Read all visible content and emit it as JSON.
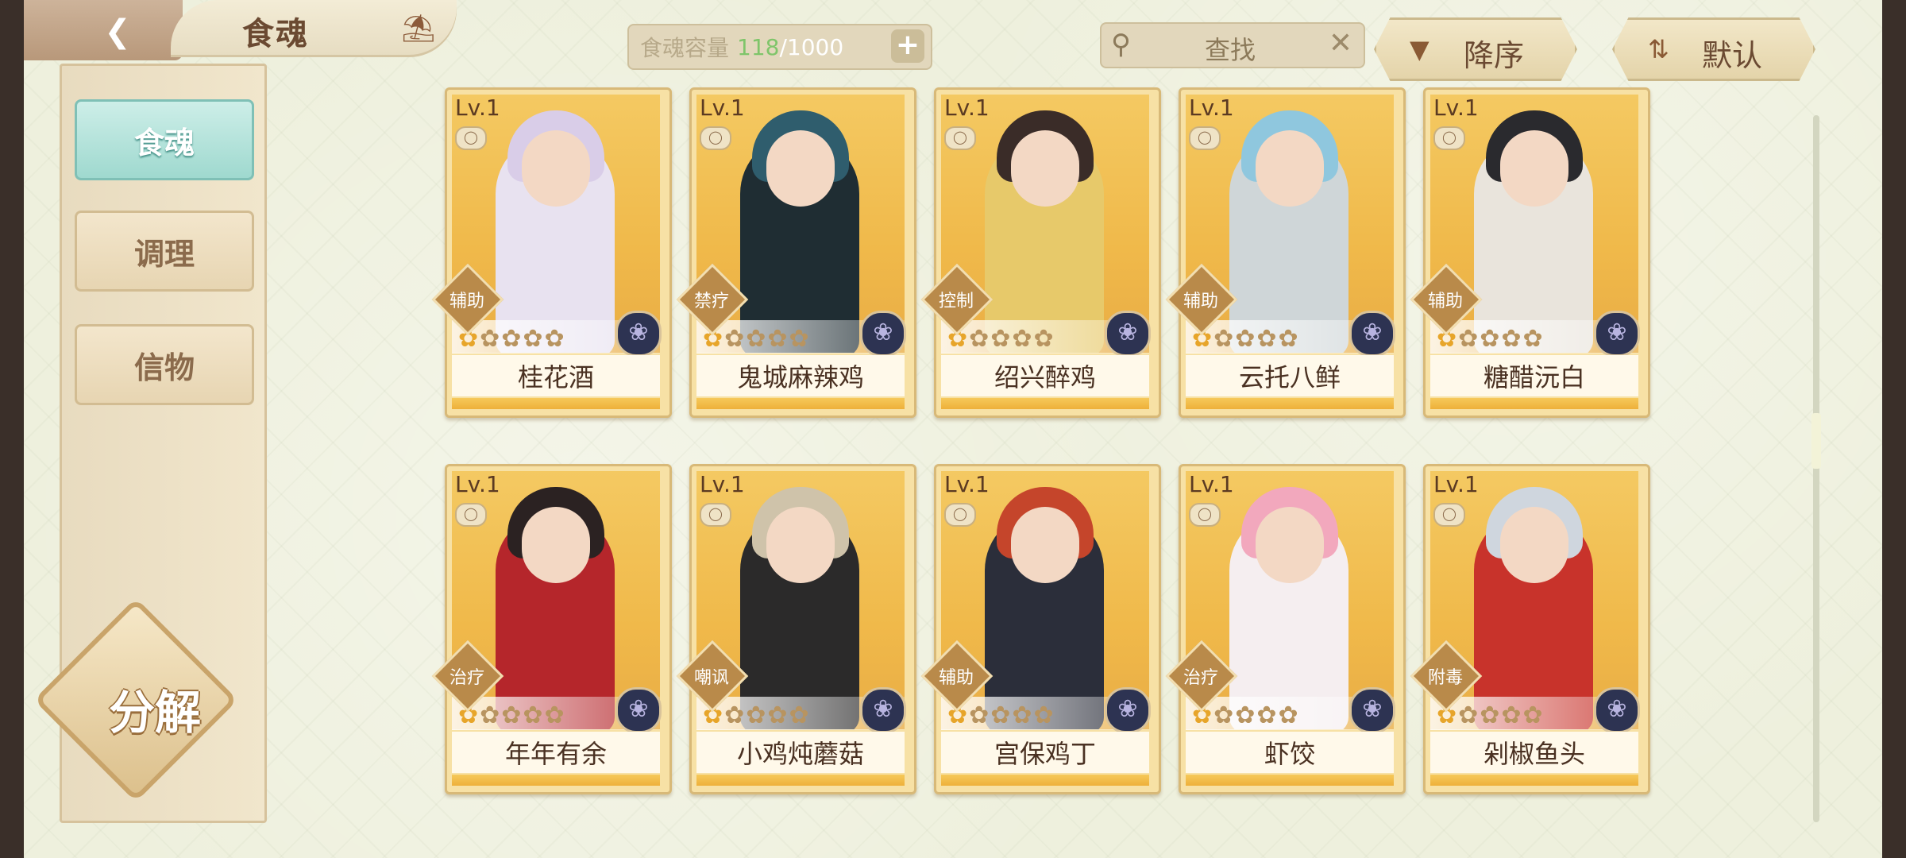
{
  "header": {
    "title": "食魂",
    "capacity_label": "食魂容量",
    "capacity_current": "118",
    "capacity_max": "/1000",
    "search_text": "查找",
    "sort_desc_label": "降序",
    "sort_default_label": "默认"
  },
  "sidebar": {
    "items": [
      {
        "label": "食魂",
        "active": true
      },
      {
        "label": "调理",
        "active": false
      },
      {
        "label": "信物",
        "active": false
      }
    ],
    "decompose_label": "分解"
  },
  "cards": [
    {
      "level": "Lv.1",
      "role": "辅助",
      "name": "桂花酒",
      "hair": "#d9cde8",
      "outfit": "#e8e2f0"
    },
    {
      "level": "Lv.1",
      "role": "禁疗",
      "name": "鬼城麻辣鸡",
      "hair": "#2f5d6d",
      "outfit": "#1f2d33"
    },
    {
      "level": "Lv.1",
      "role": "控制",
      "name": "绍兴醉鸡",
      "hair": "#3a2c28",
      "outfit": "#e7c96a"
    },
    {
      "level": "Lv.1",
      "role": "辅助",
      "name": "云托八鲜",
      "hair": "#8fc7de",
      "outfit": "#cfd6d8"
    },
    {
      "level": "Lv.1",
      "role": "辅助",
      "name": "糖醋沅白",
      "hair": "#2a2a2e",
      "outfit": "#e9e4dc"
    },
    {
      "level": "Lv.1",
      "role": "治疗",
      "name": "年年有余",
      "hair": "#2b2222",
      "outfit": "#b5262b"
    },
    {
      "level": "Lv.1",
      "role": "嘲讽",
      "name": "小鸡炖蘑菇",
      "hair": "#cfc3aa",
      "outfit": "#2b2a2a"
    },
    {
      "level": "Lv.1",
      "role": "辅助",
      "name": "宫保鸡丁",
      "hair": "#c5452b",
      "outfit": "#2b2e3a"
    },
    {
      "level": "Lv.1",
      "role": "治疗",
      "name": "虾饺",
      "hair": "#f2a8bd",
      "outfit": "#f5eef0"
    },
    {
      "level": "Lv.1",
      "role": "附毒",
      "name": "剁椒鱼头",
      "hair": "#cfd6de",
      "outfit": "#c8332b"
    }
  ]
}
